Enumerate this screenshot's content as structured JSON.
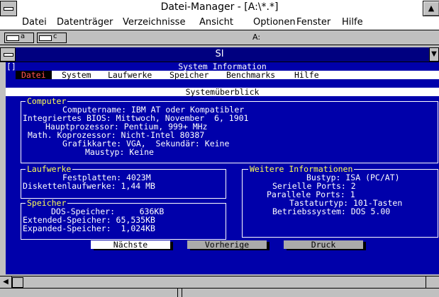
{
  "window": {
    "title": "Datei-Manager - [A:\\*.*]"
  },
  "menubar": [
    {
      "label": "Datei"
    },
    {
      "label": "Datenträger"
    },
    {
      "label": "Verzeichnisse"
    },
    {
      "label": "Ansicht"
    },
    {
      "label": "Optionen"
    },
    {
      "label": "Fenster"
    },
    {
      "label": "Hilfe"
    }
  ],
  "drives": [
    {
      "label": "a"
    },
    {
      "label": "c"
    }
  ],
  "current_drive": "A:",
  "si_window": {
    "title": "SI",
    "sys_marker": "[]",
    "app_title": "System Information"
  },
  "si_menu": [
    {
      "label": "Datei"
    },
    {
      "label": "System"
    },
    {
      "label": "Laufwerke"
    },
    {
      "label": "Speicher"
    },
    {
      "label": "Benchmarks"
    },
    {
      "label": "Hilfe"
    }
  ],
  "overview_title": "Systemüberblick",
  "computer": {
    "header": "Computer",
    "rows": [
      "Computername: IBM AT oder Kompatibler",
      "Integriertes BIOS: Mittwoch, November  6, 1901",
      "Hauptprozessor: Pentium, 999+ MHz",
      "Math. Koprozessor: Nicht-Intel 80387",
      "Grafikkarte: VGA,  Sekundär: Keine",
      "Maustyp: Keine"
    ]
  },
  "drives_box": {
    "header": "Laufwerke",
    "rows": [
      "Festplatten: 4023M",
      "Diskettenlaufwerke: 1,44 MB"
    ]
  },
  "memory": {
    "header": "Speicher",
    "rows": [
      "DOS-Speicher:     636KB",
      "Extended-Speicher: 65,535KB",
      "Expanded-Speicher:  1,024KB"
    ]
  },
  "more_info": {
    "header": "Weitere Informationen",
    "rows": [
      "Bustyp: ISA (PC/AT)",
      "Serielle Ports: 2",
      "Parallele Ports: 1",
      "Tastaturtyp: 101-Tasten",
      "Betriebssystem: DOS 5.00"
    ]
  },
  "buttons": [
    {
      "label": "Nächste"
    },
    {
      "label": "Vorherige"
    },
    {
      "label": "Druck"
    }
  ],
  "colors": {
    "dos_bg": "#0000aa",
    "title_bg": "#000080",
    "menu_hotkey": "#aa0000",
    "highlight": "#ffff55"
  }
}
